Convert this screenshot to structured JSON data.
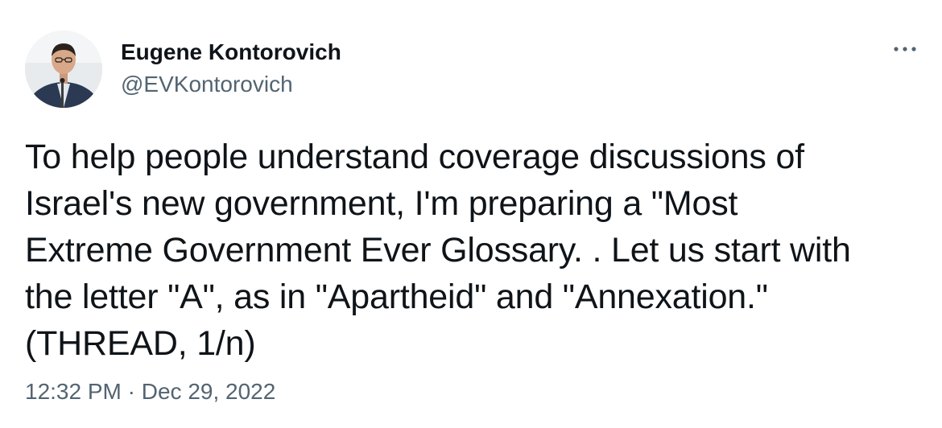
{
  "author": {
    "display_name": "Eugene Kontorovich",
    "handle": "@EVKontorovich"
  },
  "tweet": {
    "lines": [
      "To help people understand coverage discussions of",
      "Israel's new government, I'm preparing a \"Most",
      "Extreme Government Ever Glossary. . Let us start with",
      "the letter \"A\", as in \"Apartheid\" and \"Annexation.\"",
      "(THREAD, 1/n)"
    ],
    "time": "12:32 PM",
    "separator": "·",
    "date": "Dec 29, 2022"
  },
  "icons": {
    "more": "more-horizontal-icon",
    "avatar": "profile-photo"
  },
  "colors": {
    "text_primary": "#0f1419",
    "text_secondary": "#536471",
    "background": "#ffffff"
  }
}
